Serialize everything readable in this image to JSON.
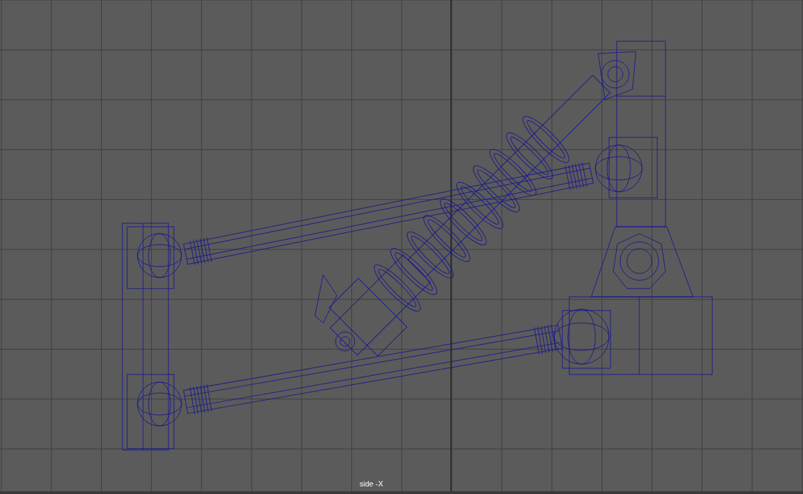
{
  "viewport": {
    "camera_label": "side -X"
  }
}
